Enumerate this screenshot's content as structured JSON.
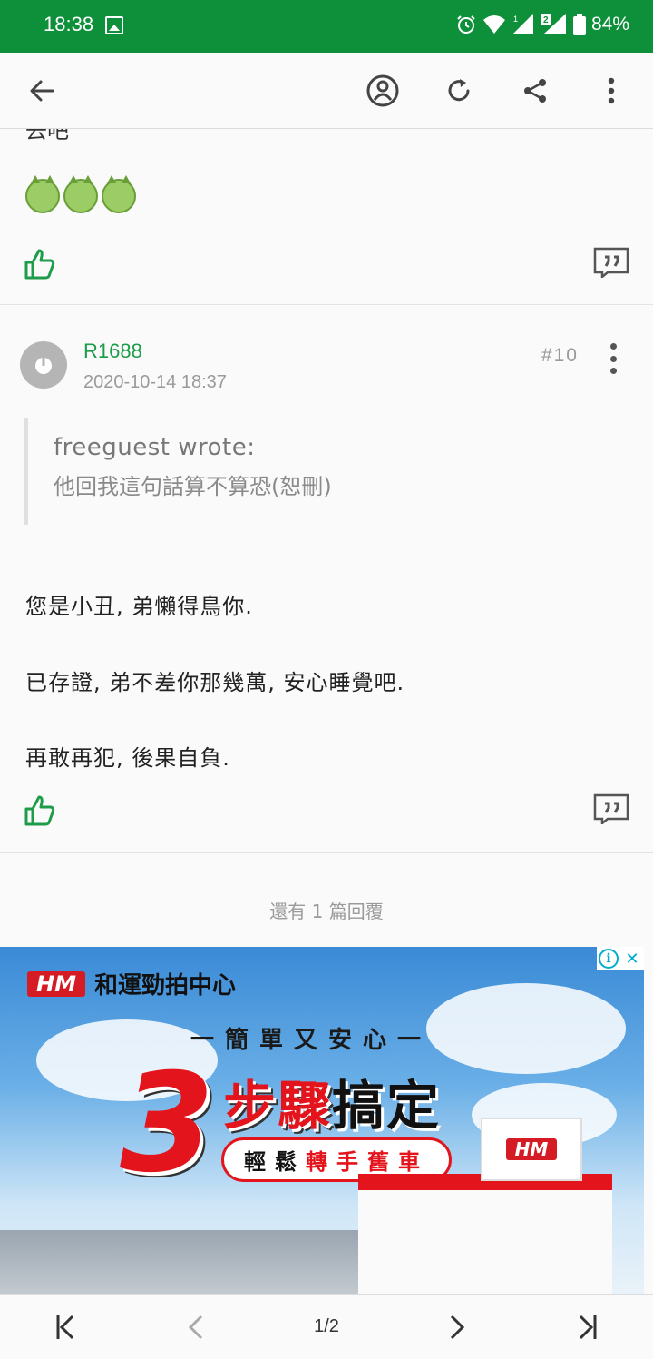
{
  "status_bar": {
    "time": "18:38",
    "battery": "84%",
    "icons": [
      "gallery-icon",
      "alarm-icon",
      "wifi-icon",
      "signal-sim1-icon",
      "signal-sim2-icon",
      "battery-icon"
    ]
  },
  "toolbar": {
    "icons": [
      "back-arrow-icon",
      "user-circle-icon",
      "refresh-icon",
      "share-icon",
      "more-vert-icon"
    ]
  },
  "prev_post": {
    "cut_text": "去吧",
    "emoji_count": 3,
    "emoji_icon": "vomit-face-emoji-icon"
  },
  "post": {
    "username": "R1688",
    "timestamp": "2020-10-14 18:37",
    "post_number": "#10",
    "quote": {
      "author_line": "freeguest wrote:",
      "text": "他回我這句話算不算恐(恕刪)"
    },
    "body": [
      "您是小丑, 弟懶得鳥你.",
      "已存證, 弟不差你那幾萬, 安心睡覺吧.",
      "再敢再犯, 後果自負."
    ]
  },
  "more_replies": "還有 1 篇回覆",
  "ad": {
    "brand_logo": "HM",
    "brand_name": "和運勁拍中心",
    "subtitle": "一簡單又安心一",
    "big_number": "3",
    "headline_red": "步驟",
    "headline_dark": "搞定",
    "pill_dark": "輕鬆",
    "pill_red": "轉手舊車",
    "sign_logo": "HM",
    "info_glyph": "i",
    "close_glyph": "✕",
    "colors": {
      "accent": "#e3141c",
      "sky": "#3a8ad6"
    }
  },
  "pagination": {
    "page_indicator": "1/2",
    "icons": [
      "first-page-icon",
      "prev-page-icon",
      "next-page-icon",
      "last-page-icon"
    ]
  },
  "colors": {
    "status_bar": "#0e8f3a",
    "username": "#1d9c4a",
    "like_icon": "#1d9c4a"
  }
}
